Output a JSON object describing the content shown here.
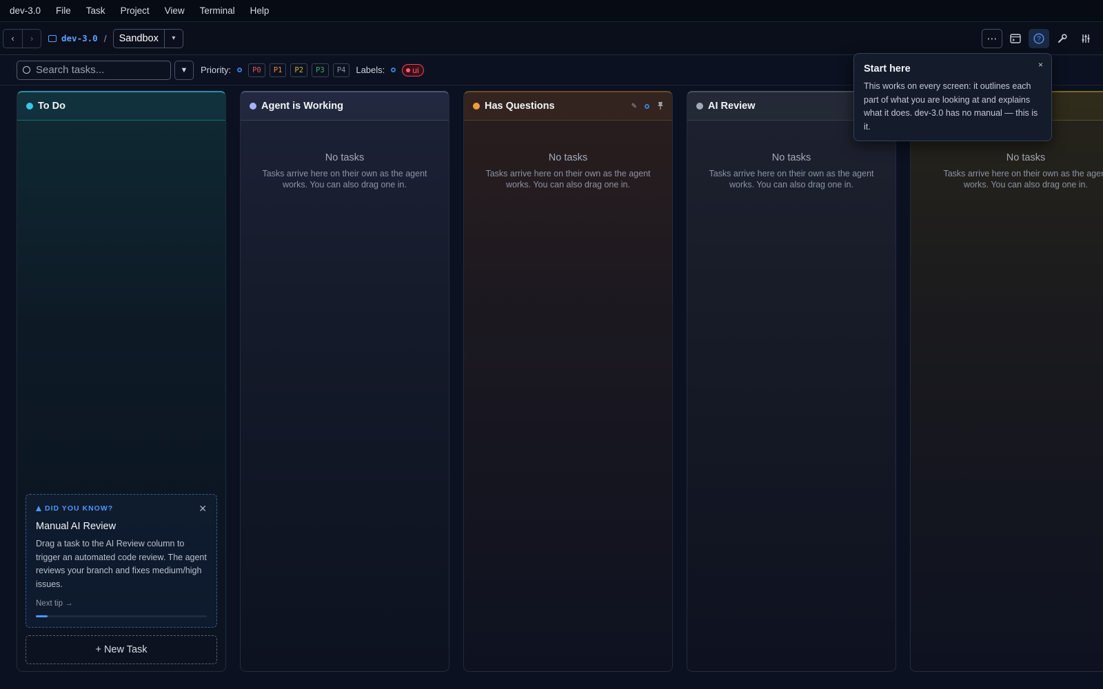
{
  "menu": [
    "dev-3.0",
    "File",
    "Task",
    "Project",
    "View",
    "Terminal",
    "Help"
  ],
  "toolbar": {
    "back_icon": "chevron-left-icon",
    "forward_icon": "chevron-right-icon",
    "project_name": "dev-3.0",
    "separator": "/",
    "branch": "Sandbox",
    "right_icons": [
      "more-icon",
      "terminal-icon",
      "help-icon",
      "wrench-icon",
      "sliders-icon"
    ]
  },
  "filter": {
    "search_placeholder": "Search tasks...",
    "priority_label": "Priority:",
    "priorities": [
      {
        "label": "P0",
        "color": "#e0555f"
      },
      {
        "label": "P1",
        "color": "#e88a3c"
      },
      {
        "label": "P2",
        "color": "#d8b13a"
      },
      {
        "label": "P3",
        "color": "#3fae67"
      },
      {
        "label": "P4",
        "color": "#8a93a3"
      }
    ],
    "labels_label": "Labels:",
    "label_chip": "ui"
  },
  "columns": [
    {
      "title": "To Do",
      "color": "#39c6e6"
    },
    {
      "title": "Agent is Working",
      "color": "#a7b2ff",
      "empty_title": "No tasks",
      "empty_text": "Tasks arrive here on their own as the agent works. You can also drag one in."
    },
    {
      "title": "Has Questions",
      "color": "#f29a3d",
      "empty_title": "No tasks",
      "empty_text": "Tasks arrive here on their own as the agent works. You can also drag one in."
    },
    {
      "title": "AI Review",
      "color": "#a3aab6",
      "empty_title": "No tasks",
      "empty_text": "Tasks arrive here on their own as the agent works. You can also drag one in."
    },
    {
      "title": "",
      "color": "#c9b13a",
      "empty_title": "No tasks",
      "empty_text": "Tasks arrive here on their own as the agent works. You can also drag one in."
    }
  ],
  "tip": {
    "kicker": "DID YOU KNOW?",
    "title": "Manual AI Review",
    "body": "Drag a task to the AI Review column to trigger an automated code review. The agent reviews your branch and fixes medium/high issues.",
    "next": "Next tip →",
    "progress": 0.07
  },
  "new_task": "+ New Task",
  "popover": {
    "title": "Start here",
    "body": "This works on every screen: it outlines each part of what you are looking at and explains what it does. dev-3.0 has no manual — this is it.",
    "close": "×"
  }
}
